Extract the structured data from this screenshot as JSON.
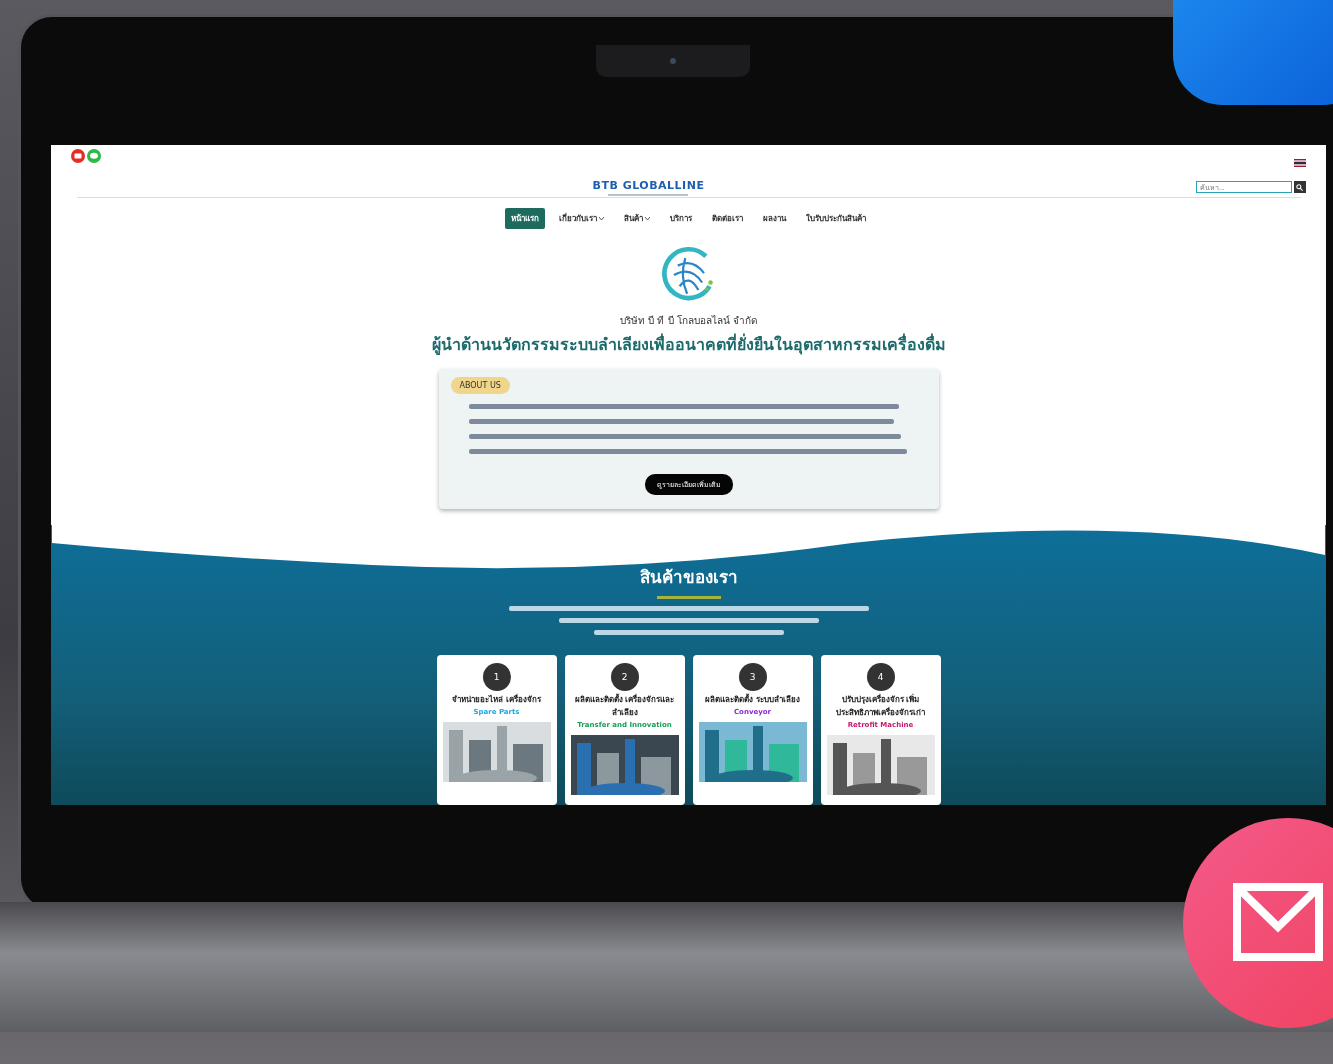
{
  "site": {
    "logo": "BTB GLOBALLINE",
    "search": {
      "placeholder": "ค้นหา..."
    },
    "nav": [
      {
        "label": "หน้าแรก",
        "selected": true,
        "dropdown": false
      },
      {
        "label": "เกี่ยวกับเรา",
        "selected": false,
        "dropdown": true
      },
      {
        "label": "สินค้า",
        "selected": false,
        "dropdown": true
      },
      {
        "label": "บริการ",
        "selected": false,
        "dropdown": false
      },
      {
        "label": "ติดต่อเรา",
        "selected": false,
        "dropdown": false
      },
      {
        "label": "ผลงาน",
        "selected": false,
        "dropdown": false
      },
      {
        "label": "ใบรับประกันสินค้า",
        "selected": false,
        "dropdown": false
      }
    ],
    "company": "บริษัท บี ที บี โกลบอลไลน์ จำกัด",
    "headline": "ผู้นำด้านนวัตกรรมระบบลำเลียงเพื่ออนาคตที่ยั่งยืนในอุตสาหกรรมเครื่องดื่ม",
    "about": {
      "badge": "ABOUT US",
      "button": "ดูรายละเอียดเพิ่มเติม"
    },
    "products": {
      "title": "สินค้าของเรา",
      "cards": [
        {
          "number": "1",
          "title": "จำหน่ายอะไหล่ เครื่องจักร",
          "subtitle": "Spare Parts",
          "color": "#1fa8e0"
        },
        {
          "number": "2",
          "title": "ผลิตและติดตั้ง เครื่องจักรและลำเลียง",
          "subtitle": "Transfer and Innovation",
          "color": "#17a05a"
        },
        {
          "number": "3",
          "title": "ผลิตและติดตั้ง ระบบลำเลียง",
          "subtitle": "Conveyor",
          "color": "#8a2bd0"
        },
        {
          "number": "4",
          "title": "ปรับปรุงเครื่องจักร เพิ่มประสิทธิภาพเครื่องจักรเก่า",
          "subtitle": "Retrofit Machine",
          "color": "#c8186a"
        }
      ]
    }
  }
}
